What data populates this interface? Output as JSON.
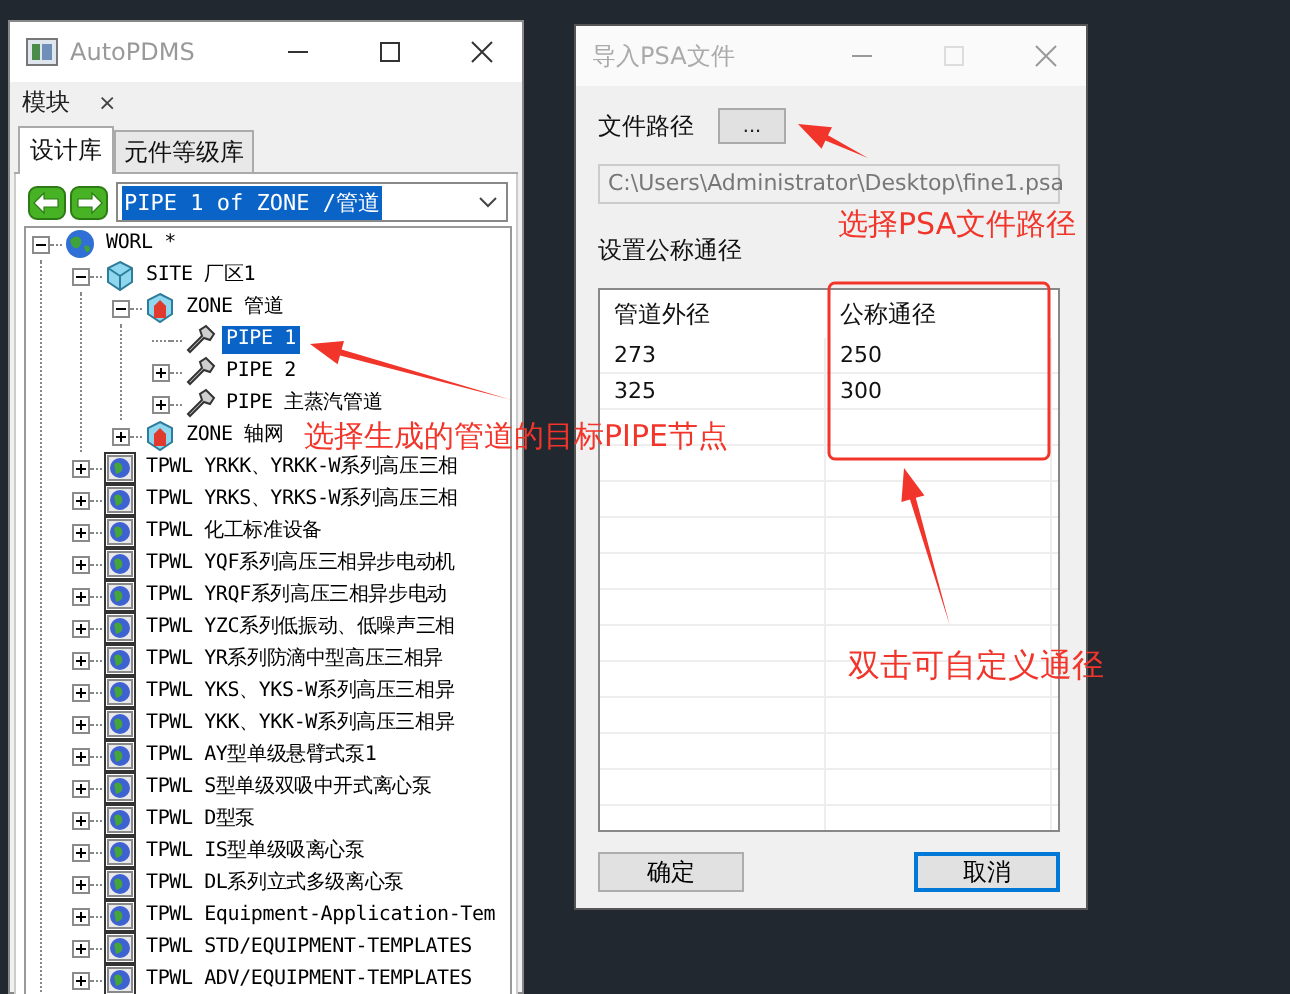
{
  "main_window": {
    "title": "AutoPDMS",
    "module_tab": {
      "label": "模块",
      "close": "×"
    },
    "tabs": [
      {
        "label": "设计库",
        "selected": true
      },
      {
        "label": "元件等级库",
        "selected": false
      }
    ],
    "address": {
      "value": "PIPE 1 of ZONE /管道"
    },
    "tree": [
      {
        "label": "WORL *",
        "kind": "world",
        "leaf": false,
        "expanded": true,
        "selected": false,
        "children": [
          {
            "label": "SITE 厂区1",
            "kind": "site",
            "leaf": false,
            "expanded": true,
            "selected": false,
            "children": [
              {
                "label": "ZONE 管道",
                "kind": "zone",
                "leaf": false,
                "expanded": true,
                "selected": false,
                "children": [
                  {
                    "label": "PIPE 1",
                    "kind": "pipe",
                    "leaf": true,
                    "selected": true
                  },
                  {
                    "label": "PIPE 2",
                    "kind": "pipe",
                    "leaf": false,
                    "expanded": false,
                    "selected": false
                  },
                  {
                    "label": "PIPE 主蒸汽管道",
                    "kind": "pipe",
                    "leaf": false,
                    "expanded": false,
                    "selected": false
                  }
                ]
              },
              {
                "label": "ZONE 轴网",
                "kind": "zone",
                "leaf": false,
                "expanded": false,
                "selected": false
              }
            ]
          },
          {
            "label": "TPWL YRKK、YRKK-W系列高压三相",
            "kind": "library",
            "leaf": false,
            "expanded": false,
            "selected": false
          },
          {
            "label": "TPWL YRKS、YRKS-W系列高压三相",
            "kind": "library",
            "leaf": false,
            "expanded": false,
            "selected": false
          },
          {
            "label": "TPWL 化工标准设备",
            "kind": "library",
            "leaf": false,
            "expanded": false,
            "selected": false
          },
          {
            "label": "TPWL YQF系列高压三相异步电动机",
            "kind": "library",
            "leaf": false,
            "expanded": false,
            "selected": false
          },
          {
            "label": "TPWL YRQF系列高压三相异步电动",
            "kind": "library",
            "leaf": false,
            "expanded": false,
            "selected": false
          },
          {
            "label": "TPWL YZC系列低振动、低噪声三相",
            "kind": "library",
            "leaf": false,
            "expanded": false,
            "selected": false
          },
          {
            "label": "TPWL YR系列防滴中型高压三相异",
            "kind": "library",
            "leaf": false,
            "expanded": false,
            "selected": false
          },
          {
            "label": "TPWL YKS、YKS-W系列高压三相异",
            "kind": "library",
            "leaf": false,
            "expanded": false,
            "selected": false
          },
          {
            "label": "TPWL YKK、YKK-W系列高压三相异",
            "kind": "library",
            "leaf": false,
            "expanded": false,
            "selected": false
          },
          {
            "label": "TPWL AY型单级悬臂式泵1",
            "kind": "library",
            "leaf": false,
            "expanded": false,
            "selected": false
          },
          {
            "label": "TPWL S型单级双吸中开式离心泵",
            "kind": "library",
            "leaf": false,
            "expanded": false,
            "selected": false
          },
          {
            "label": "TPWL D型泵",
            "kind": "library",
            "leaf": false,
            "expanded": false,
            "selected": false
          },
          {
            "label": "TPWL IS型单级吸离心泵",
            "kind": "library",
            "leaf": false,
            "expanded": false,
            "selected": false
          },
          {
            "label": "TPWL DL系列立式多级离心泵",
            "kind": "library",
            "leaf": false,
            "expanded": false,
            "selected": false
          },
          {
            "label": "TPWL Equipment-Application-Tem",
            "kind": "library",
            "leaf": false,
            "expanded": false,
            "selected": false
          },
          {
            "label": "TPWL STD/EQUIPMENT-TEMPLATES",
            "kind": "library",
            "leaf": false,
            "expanded": false,
            "selected": false
          },
          {
            "label": "TPWL ADV/EQUIPMENT-TEMPLATES",
            "kind": "library",
            "leaf": false,
            "expanded": false,
            "selected": false
          }
        ]
      }
    ]
  },
  "dialog": {
    "title": "导入PSA文件",
    "path_label": "文件路径",
    "browse_button": "...",
    "path_field": {
      "value": "C:\\Users\\Administrator\\Desktop\\fine1.psa"
    },
    "section_label": "设置公称通径",
    "table": {
      "columns": [
        "管道外径",
        "公称通径"
      ],
      "rows": [
        [
          "273",
          "250"
        ],
        [
          "325",
          "300"
        ]
      ]
    },
    "buttons": [
      {
        "label": "确定",
        "focused": false
      },
      {
        "label": "取消",
        "focused": true
      }
    ]
  },
  "annotations": [
    {
      "text": "选择生成的管道的目标PIPE节点"
    },
    {
      "text": "选择PSA文件路径"
    },
    {
      "text": "双击可自定义通径"
    }
  ]
}
